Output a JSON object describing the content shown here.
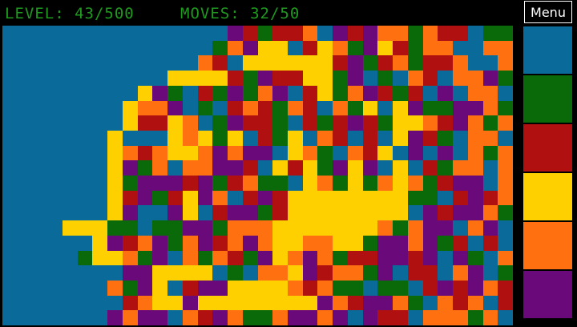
{
  "hud": {
    "level_text": "LEVEL: 43/500",
    "moves_text": "MOVES: 32/50",
    "level": 43,
    "level_total": 500,
    "moves": 32,
    "moves_max": 50
  },
  "menu": {
    "label": "Menu"
  },
  "palette": [
    {
      "name": "blue",
      "color": "#0a6a9a"
    },
    {
      "name": "green",
      "color": "#0a6a0a"
    },
    {
      "name": "red",
      "color": "#b01010"
    },
    {
      "name": "yellow",
      "color": "#ffd000"
    },
    {
      "name": "orange",
      "color": "#ff7010"
    },
    {
      "name": "purple",
      "color": "#6a0a7a"
    }
  ],
  "board": {
    "columns": 34,
    "rows": 20,
    "flooded_color": "blue",
    "cell_colors": [
      "BBBBBBBBBBBBBBBPRGRROBPRPOOGORRBGG",
      "BBBBBBBBBBBBBBGOPYYBRYOGPYRGOOBBOO",
      "BBBBBBBBBBBBBORBYYYYYYRPGROGRROBBO",
      "BBBBBBBBBBBYYYYRGPRRYYGPBGBORBOOPG",
      "BBBBBBBBBYPGBRGPGOPBRYGOPRGRBPBOOB",
      "BBBBBBBBYOOPBGBRORGORBOGYBYPGGPPOG",
      "BBBBBBBBYRRYOBGPRRGBRGRPRGYYORPOGO",
      "BBBBBBBYBBBYOYGYBRGYBORBRBYPRGBOOB",
      "BBBBBBBYOROYYOPOPPBYOGBORYBPBPBOGO",
      "BBBBBBBYPGOBOOPPRBYRYGPYPBYBRGOOBO",
      "BBBBBBBYGPPPRPGROGGBYOGYGOYOGRPPBO",
      "BBBBBBBYRPGRYPOBRPRYYYYYYYYGGBRPRO",
      "BBBBBBBYPBBPYBRPPGRYYYYYYYYBPRPPOG",
      "BBBBYYYGGBGGPPGOOOYYYYYYYOGOPPBOPB",
      "BBBBBBYPROPGOPROPOYYOOYYGPPOPGRBRB",
      "BBBBBGYYOGPBOGORGPYOPOGRRPPRPBPGBO",
      "BBBBBBBBPPYYYYBGBOOYPROOGPBRRBOPBG",
      "BBBBBBBOGPYBRPPYYYYOROGGBGGBRPRPOR",
      "BBBBBBBBROYYPYYYYYYYYPORPPOGBOROBR",
      "BBBBBBBPOPPBORPOGGOPPOPBPRRBOOOGOB"
    ]
  }
}
